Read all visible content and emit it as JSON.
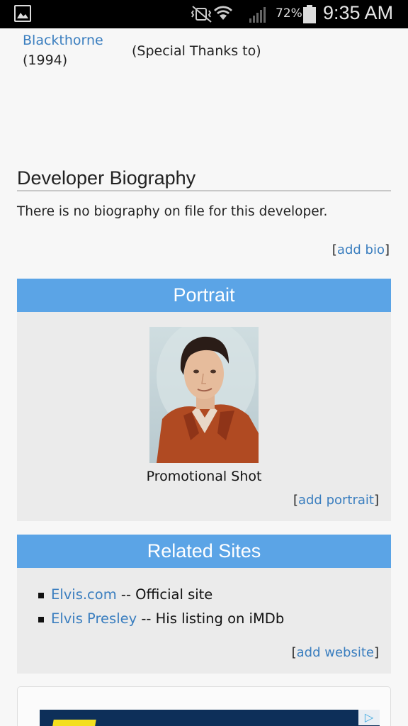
{
  "status_bar": {
    "battery_percent": "72%",
    "time": "9:35 AM",
    "icons": [
      "gallery-icon",
      "vibrate-mute-icon",
      "wifi-icon",
      "signal-icon",
      "battery-icon"
    ]
  },
  "credit": {
    "game_title": "Blackthorne",
    "year": "(1994)",
    "role": "(Special Thanks to)"
  },
  "biography": {
    "heading": "Developer Biography",
    "text": "There is no biography on file for this developer.",
    "add_link": "add bio"
  },
  "portrait": {
    "heading": "Portrait",
    "caption": "Promotional Shot",
    "add_link": "add portrait"
  },
  "related_sites": {
    "heading": "Related Sites",
    "items": [
      {
        "link": "Elvis.com",
        "desc": " -- Official site"
      },
      {
        "link": "Elvis Presley",
        "desc": " -- His listing on iMDb"
      }
    ],
    "add_link": "add website"
  },
  "colors": {
    "link": "#3a7ebf",
    "panel_header": "#5ba4e6",
    "panel_bg": "#ebebeb",
    "page_bg": "#f7f7f7"
  }
}
